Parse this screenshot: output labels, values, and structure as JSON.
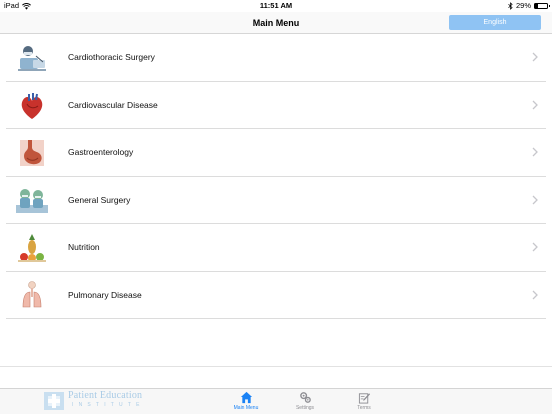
{
  "status_bar": {
    "device": "iPad",
    "time": "11:51 AM",
    "battery": "29%",
    "battery_level": 0.29
  },
  "nav": {
    "title": "Main Menu",
    "language_button": "English"
  },
  "menu": {
    "items": [
      {
        "label": "Cardiothoracic Surgery",
        "icon": "surgeon-icon"
      },
      {
        "label": "Cardiovascular Disease",
        "icon": "heart-icon"
      },
      {
        "label": "Gastroenterology",
        "icon": "stomach-icon"
      },
      {
        "label": "General Surgery",
        "icon": "surgical-team-icon"
      },
      {
        "label": "Nutrition",
        "icon": "fruit-icon"
      },
      {
        "label": "Pulmonary Disease",
        "icon": "lungs-icon"
      }
    ]
  },
  "tab_bar": {
    "logo_line1": "Patient Education",
    "logo_line2": "INSTITUTE",
    "tabs": [
      {
        "label": "Main Menu",
        "icon": "home-icon",
        "active": true
      },
      {
        "label": "Settings",
        "icon": "gears-icon",
        "active": false
      },
      {
        "label": "Terms",
        "icon": "edit-icon",
        "active": false
      }
    ]
  },
  "colors": {
    "accent": "#1a82f5",
    "language_button_bg": "#8fc3f3",
    "logo_color": "#a9cbe6"
  }
}
